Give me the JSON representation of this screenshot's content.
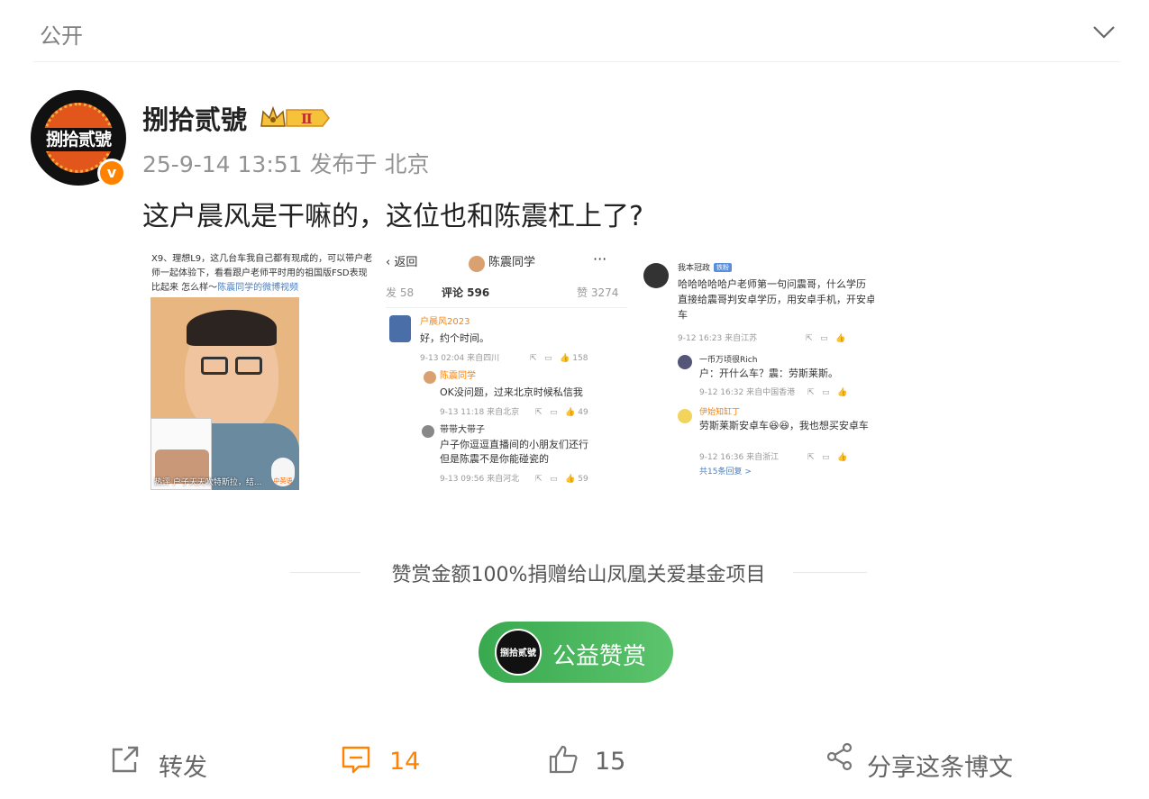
{
  "header": {
    "visibility": "公开"
  },
  "post": {
    "author": "捌拾贰號",
    "avatar_text": "捌拾贰號",
    "vip_level": "Ⅱ",
    "timestamp": "25-9-14 13:51",
    "source": "发布于 北京",
    "text": "这户晨风是干嘛的，这位也和陈震杠上了?"
  },
  "image1": {
    "caption_line1": "X9、理想L9，这几台车我自己都有现成的，可以带户老",
    "caption_line2": "师一起体验下，看看跟户老师平时用的祖国版FSD表现",
    "caption_line3_prefix": "比起来 怎么样～",
    "caption_link": "陈震同学的微博视频",
    "thumb_caption": "热评  户子天天吹特斯拉，结...",
    "thumb_badge": "中英语"
  },
  "image2": {
    "back": "返回",
    "title": "陈震同学",
    "tab_repost": "发 58",
    "tab_comment": "评论 596",
    "tab_like": "赞 3274",
    "c1_user": "户晨风2023",
    "c1_text": "好，约个时间。",
    "c1_time": "9-13 02:04 来自四川",
    "c1_likes": "158",
    "c2_user": "陈震同学",
    "c2_text": "OK没问题，过来北京时候私信我",
    "c2_time": "9-13 11:18 来自北京",
    "c2_likes": "49",
    "c3_user": "带带大带子",
    "c3_text1": "户子你逗逗直播间的小朋友们还行",
    "c3_text2": "但是陈震不是你能碰瓷的",
    "c3_time": "9-13 09:56 来自河北",
    "c3_likes": "59"
  },
  "image3": {
    "user": "我本冠政",
    "badge": "铁粉",
    "text1": "哈哈哈哈哈户老师第一句问震哥，什么学历",
    "text2": "直接给震哥判安卓学历，用安卓手机，开安卓",
    "text3": "车",
    "time": "9-12 16:23 来自江苏",
    "r1_user": "一币万顷很Rich",
    "r1_text": "户：开什么车？震：劳斯莱斯。",
    "r1_time": "9-12 16:32 来自中国香港",
    "r2_user": "伊始知缸丁",
    "r2_text1": "劳斯莱斯安卓车",
    "r2_text2": "，我也想买安卓车",
    "r2_time": "9-12 16:36 来自浙江",
    "more": "共15条回复 >"
  },
  "donation": {
    "text": "赞赏金额100%捐赠给山凤凰关爱基金项目",
    "button_label": "公益赞赏",
    "button_avatar_text": "捌拾贰號"
  },
  "actions": {
    "repost_label": "转发",
    "comment_count": "14",
    "like_count": "15",
    "share_label": "分享这条博文"
  },
  "colors": {
    "accent": "#ff8200",
    "reward_green": "#39a94f"
  }
}
